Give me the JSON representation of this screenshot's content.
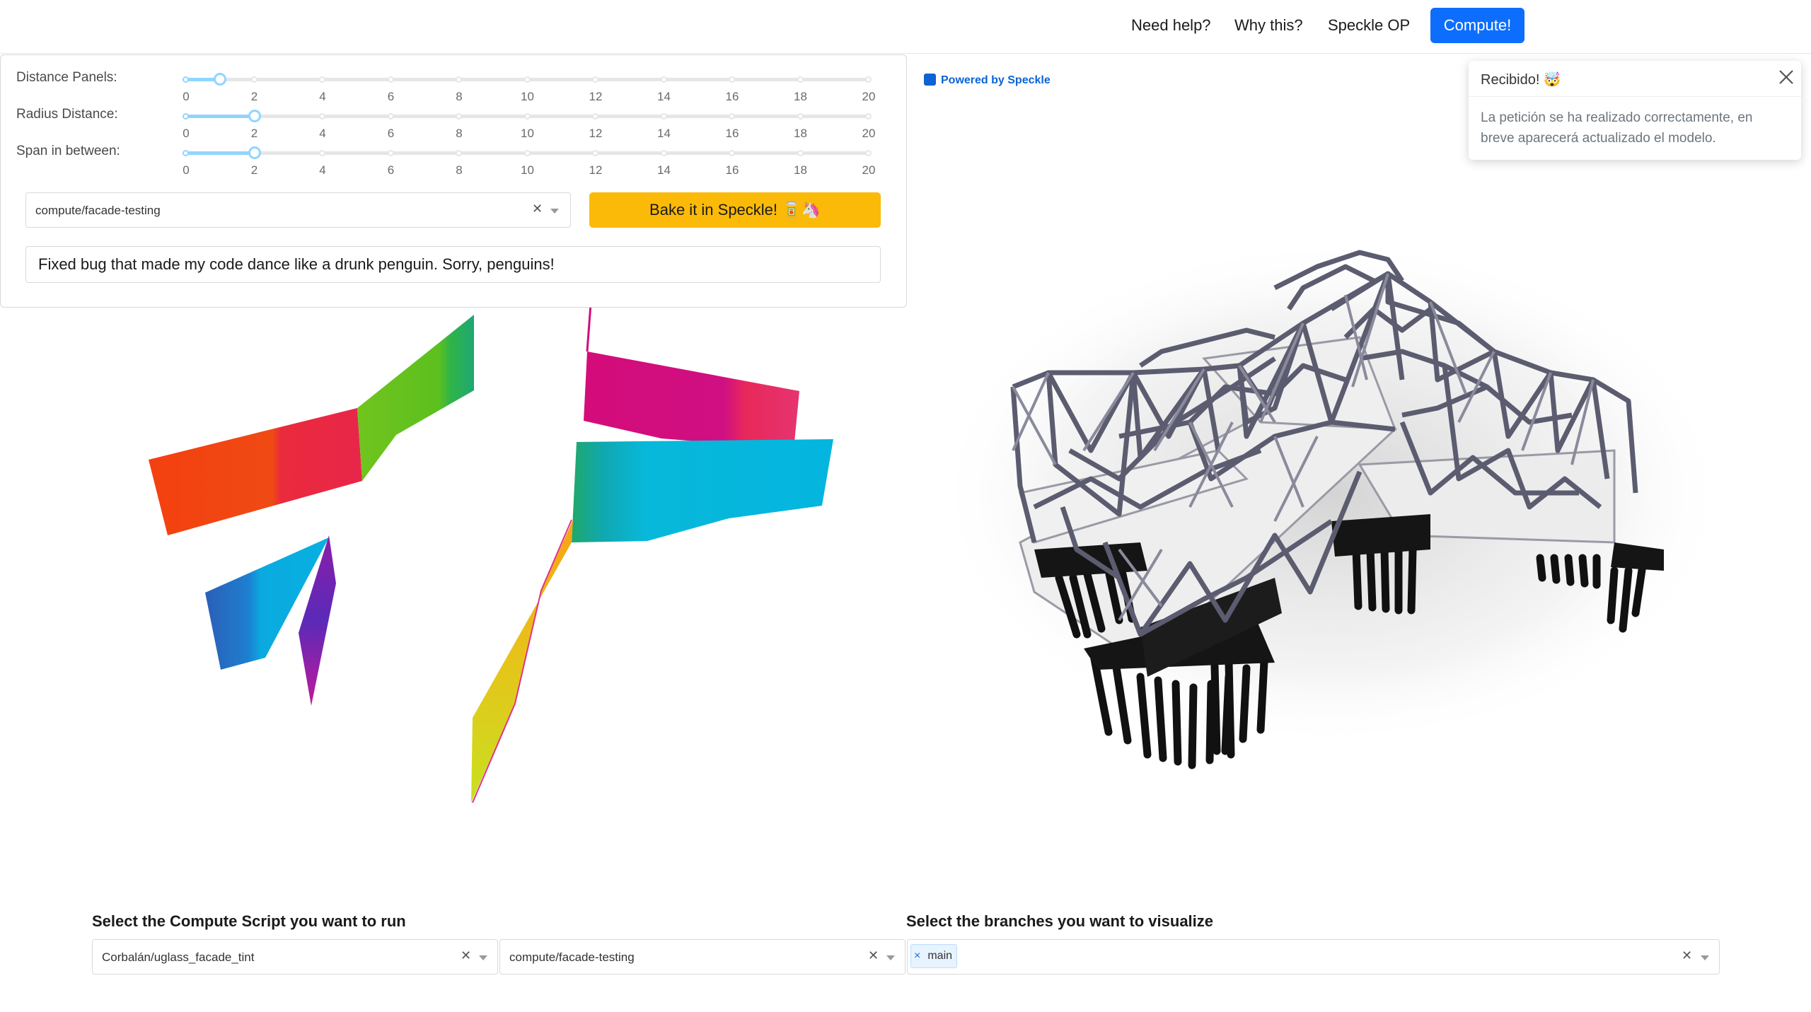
{
  "nav": {
    "help": "Need help?",
    "why": "Why this?",
    "speckle_op": "Speckle OP",
    "compute": "Compute!"
  },
  "controls": {
    "sliders": [
      {
        "label": "Distance Panels:",
        "value": 1
      },
      {
        "label": "Radius Distance:",
        "value": 2
      },
      {
        "label": "Span in between:",
        "value": 2
      }
    ],
    "ticks": [
      "0",
      "2",
      "4",
      "6",
      "8",
      "10",
      "12",
      "14",
      "16",
      "18",
      "20"
    ],
    "branch_select": "compute/facade-testing",
    "bake_label": "Bake it in Speckle! 🥫🦄",
    "commit_message": "Fixed bug that made my code dance like a drunk penguin. Sorry, penguins!"
  },
  "viewer": {
    "powered_by": "Powered by Speckle"
  },
  "toast": {
    "title": "Recibido! 🤯",
    "body": "La petición se ha realizado correctamente, en breve aparecerá actualizado el modelo."
  },
  "bottom": {
    "script_label": "Select the Compute Script you want to run",
    "script_select": "Corbalán/uglass_facade_tint",
    "script_branch_select": "compute/facade-testing",
    "branches_label": "Select the branches you want to visualize",
    "branch_tags": [
      "main"
    ]
  },
  "colors": {
    "primary": "#0d6efd",
    "bake": "#fcba08",
    "slider": "#91d5ff"
  }
}
